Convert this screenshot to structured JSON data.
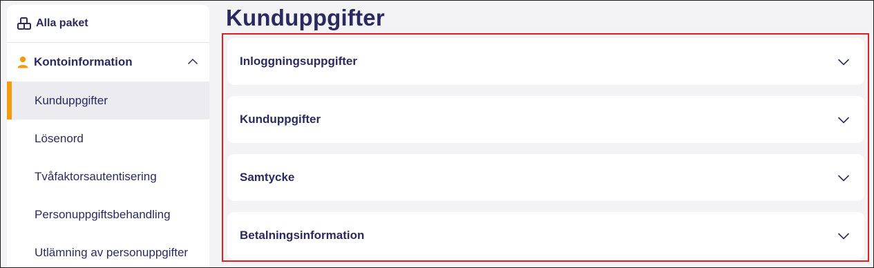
{
  "sidebar": {
    "top_label": "Alla paket",
    "section_label": "Kontoinformation",
    "items": [
      {
        "label": "Kunduppgifter",
        "active": true
      },
      {
        "label": "Lösenord"
      },
      {
        "label": "Tvåfaktorsautentisering"
      },
      {
        "label": "Personuppgiftsbehandling"
      },
      {
        "label": "Utlämning av personuppgifter"
      }
    ]
  },
  "main": {
    "title": "Kunduppgifter",
    "accordions": [
      {
        "label": "Inloggningsuppgifter"
      },
      {
        "label": "Kunduppgifter"
      },
      {
        "label": "Samtycke"
      },
      {
        "label": "Betalningsinformation"
      }
    ]
  },
  "colors": {
    "text": "#2b2a5e",
    "accent": "#f39c12",
    "highlight": "#e02020",
    "background": "#f3f3f6"
  },
  "icons": {
    "top": "packages-icon",
    "section": "person-icon",
    "section_toggle": "chevron-up-icon",
    "accordion_toggle": "chevron-down-icon"
  }
}
